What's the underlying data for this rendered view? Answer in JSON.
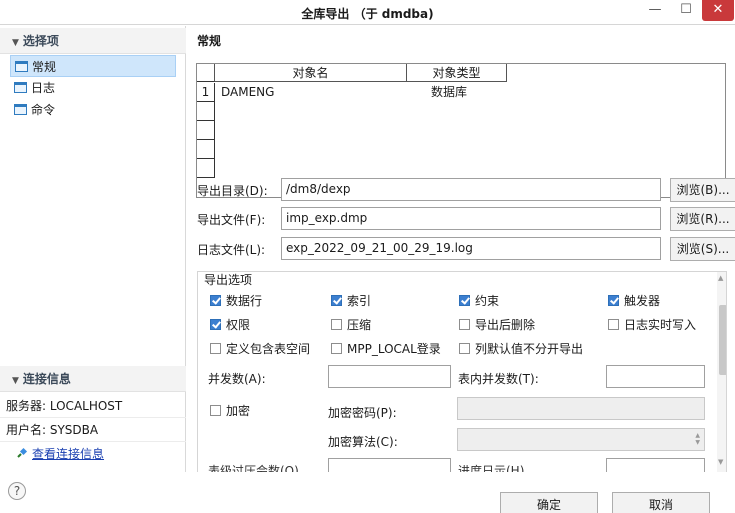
{
  "window": {
    "title": "全库导出 （于 dmdba)",
    "min_glyph": "—",
    "max_glyph": "☐",
    "close_glyph": "✕"
  },
  "sidebar": {
    "section_title": "选择项",
    "items": [
      {
        "label": "常规",
        "icon": "page-icon",
        "selected": true
      },
      {
        "label": "日志",
        "icon": "page-icon",
        "selected": false
      },
      {
        "label": "命令",
        "icon": "page-icon",
        "selected": false
      }
    ],
    "connection": {
      "section_title": "连接信息",
      "server": "服务器: LOCALHOST",
      "user": "用户名: SYSDBA",
      "link": "查看连接信息"
    }
  },
  "main": {
    "title": "常规",
    "grid": {
      "columns": [
        "对象名",
        "对象类型"
      ],
      "rows": [
        {
          "num": "1",
          "name": "DAMENG",
          "type": "数据库"
        }
      ]
    },
    "export_dir": {
      "label": "导出目录(D):",
      "value": "/dm8/dexp",
      "button": "浏览(B)..."
    },
    "export_file": {
      "label": "导出文件(F):",
      "value": "imp_exp.dmp",
      "button": "浏览(R)..."
    },
    "log_file": {
      "label": "日志文件(L):",
      "value": "exp_2022_09_21_00_29_19.log",
      "button": "浏览(S)..."
    },
    "options": {
      "legend": "导出选项",
      "checkboxes": {
        "rows": {
          "label": "数据行",
          "checked": true
        },
        "indexes": {
          "label": "索引",
          "checked": true
        },
        "constraints": {
          "label": "约束",
          "checked": true
        },
        "triggers": {
          "label": "触发器",
          "checked": true
        },
        "grants": {
          "label": "权限",
          "checked": true
        },
        "compress": {
          "label": "压缩",
          "checked": false
        },
        "drop_after": {
          "label": "导出后删除",
          "checked": false
        },
        "log_realtime": {
          "label": "日志实时写入",
          "checked": false
        },
        "tablespace": {
          "label": "定义包含表空间",
          "checked": false
        },
        "mpp_local": {
          "label": "MPP_LOCAL登录",
          "checked": false
        },
        "default_split": {
          "label": "列默认值不分开导出",
          "checked": false
        },
        "encrypt": {
          "label": "加密",
          "checked": false
        }
      },
      "parallel": {
        "label": "并发数(A):",
        "value": ""
      },
      "table_parallel": {
        "label": "表内并发数(T):",
        "value": ""
      },
      "encrypt_pwd": {
        "label": "加密密码(P):",
        "value": ""
      },
      "encrypt_alg": {
        "label": "加密算法(C):",
        "value": ""
      },
      "cut_label_1": "表级过压会数(Q)",
      "cut_label_2": "进度日示(H)"
    }
  },
  "footer": {
    "help": "?",
    "ok": "确定",
    "cancel": "取消"
  }
}
